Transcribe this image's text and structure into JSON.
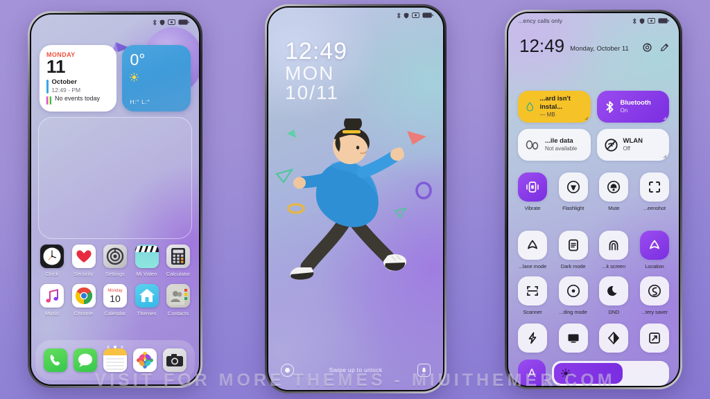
{
  "watermark": "VISIT FOR MORE THEMES - MIUITHEMER.COM",
  "phone1": {
    "name": "home-screen",
    "status": {
      "icons": [
        "bluetooth-icon",
        "shield-icon",
        "alarm-icon",
        "battery-icon"
      ]
    },
    "calendar_widget": {
      "day_of_week": "MONDAY",
      "day_number": "11",
      "month": "October",
      "time": "12:49 - PM",
      "events": "No events today"
    },
    "weather_widget": {
      "temperature": "0°",
      "condition_icon": "sun-icon",
      "high_low": "H:°  L:°"
    },
    "apps_row1": [
      {
        "label": "Clock",
        "icon": "clock-icon"
      },
      {
        "label": "Security",
        "icon": "heart-icon"
      },
      {
        "label": "Settings",
        "icon": "gear-icon"
      },
      {
        "label": "Mi Video",
        "icon": "clapperboard-icon"
      },
      {
        "label": "Calculator",
        "icon": "calculator-icon"
      }
    ],
    "apps_row2": [
      {
        "label": "Music",
        "icon": "music-note-icon"
      },
      {
        "label": "Chrome",
        "icon": "chrome-icon"
      },
      {
        "label": "Calendar",
        "icon": "calendar-icon",
        "sub": "Monday",
        "num": "10"
      },
      {
        "label": "Themes",
        "icon": "house-icon"
      },
      {
        "label": "Contacts",
        "icon": "contacts-icon"
      }
    ],
    "dock": [
      {
        "name": "phone-app",
        "icon": "phone-icon"
      },
      {
        "name": "messages-app",
        "icon": "message-bubble-icon"
      },
      {
        "name": "notes-app",
        "icon": "notes-icon"
      },
      {
        "name": "photos-app",
        "icon": "photos-flower-icon"
      },
      {
        "name": "camera-app",
        "icon": "camera-icon"
      }
    ],
    "page_dots": {
      "count": 3,
      "active_index": 1
    }
  },
  "phone2": {
    "name": "lock-screen",
    "status": {
      "icons": [
        "bluetooth-icon",
        "shield-icon",
        "alarm-icon",
        "battery-icon"
      ]
    },
    "clock": {
      "time": "12:49",
      "weekday": "MON",
      "date": "10/11"
    },
    "unlock_hint": "Swipe up to unlock",
    "left_button": "assistant-circle-icon",
    "right_button": "camera-icon"
  },
  "phone3": {
    "name": "control-center",
    "carrier": "...ency calls only",
    "status": {
      "icons": [
        "bluetooth-icon",
        "shield-icon",
        "alarm-icon",
        "battery-icon"
      ]
    },
    "time": "12:49",
    "date": "Monday, October 11",
    "header_actions": [
      "settings-icon",
      "edit-icon"
    ],
    "big_tiles": [
      {
        "title": "...ard isn't instal...",
        "sub": "--- MB",
        "icon": "sim-drop-icon",
        "color": "#f5c227",
        "text_color": "#1d1d22",
        "on": true
      },
      {
        "title": "Bluetooth",
        "sub": "On",
        "icon": "bluetooth-icon",
        "color": "#8b3ae8",
        "text_color": "#ffffff",
        "on": true
      }
    ],
    "wide_tiles": [
      {
        "title": "...ile data",
        "sub": "Not available",
        "icon": "zero-zero-icon",
        "on": false
      },
      {
        "title": "WLAN",
        "sub": "Off",
        "icon": "wifi-off-icon",
        "on": false
      }
    ],
    "toggles_row1": [
      {
        "label": "Vibrate",
        "icon": "vibrate-icon",
        "on": true
      },
      {
        "label": "Flashlight",
        "icon": "flashlight-icon",
        "on": false
      },
      {
        "label": "Mute",
        "icon": "mute-bell-icon",
        "on": false
      },
      {
        "label": "...eenshot",
        "icon": "screenshot-icon",
        "on": false
      }
    ],
    "toggles_row2": [
      {
        "label": "...lane mode",
        "icon": "airplane-icon",
        "on": false
      },
      {
        "label": "Dark mode",
        "icon": "dark-mode-icon",
        "on": false
      },
      {
        "label": "...k screen",
        "icon": "lock-screen-icon",
        "on": false
      },
      {
        "label": "Location",
        "icon": "location-icon",
        "on": true
      }
    ],
    "toggles_row3": [
      {
        "label": "Scanner",
        "icon": "scanner-icon",
        "on": false
      },
      {
        "label": "...ding mode",
        "icon": "reading-mode-icon",
        "on": false
      },
      {
        "label": "DND",
        "icon": "moon-icon",
        "on": false
      },
      {
        "label": "...tery saver",
        "icon": "battery-saver-icon",
        "on": false
      }
    ],
    "icon_row": [
      {
        "name": "power-saver-icon"
      },
      {
        "name": "cast-screen-icon"
      },
      {
        "name": "contrast-icon"
      },
      {
        "name": "screen-rotate-icon"
      }
    ],
    "brightness": {
      "auto_label": "A",
      "icon": "sun-icon",
      "percent": 62
    }
  },
  "colors": {
    "accent_purple": "#7a2ee0",
    "tile_yellow": "#f5c227",
    "bg_purple": "#9a87d6",
    "calendar_red": "#f0503c",
    "weather_blue": "#4ba6df"
  }
}
